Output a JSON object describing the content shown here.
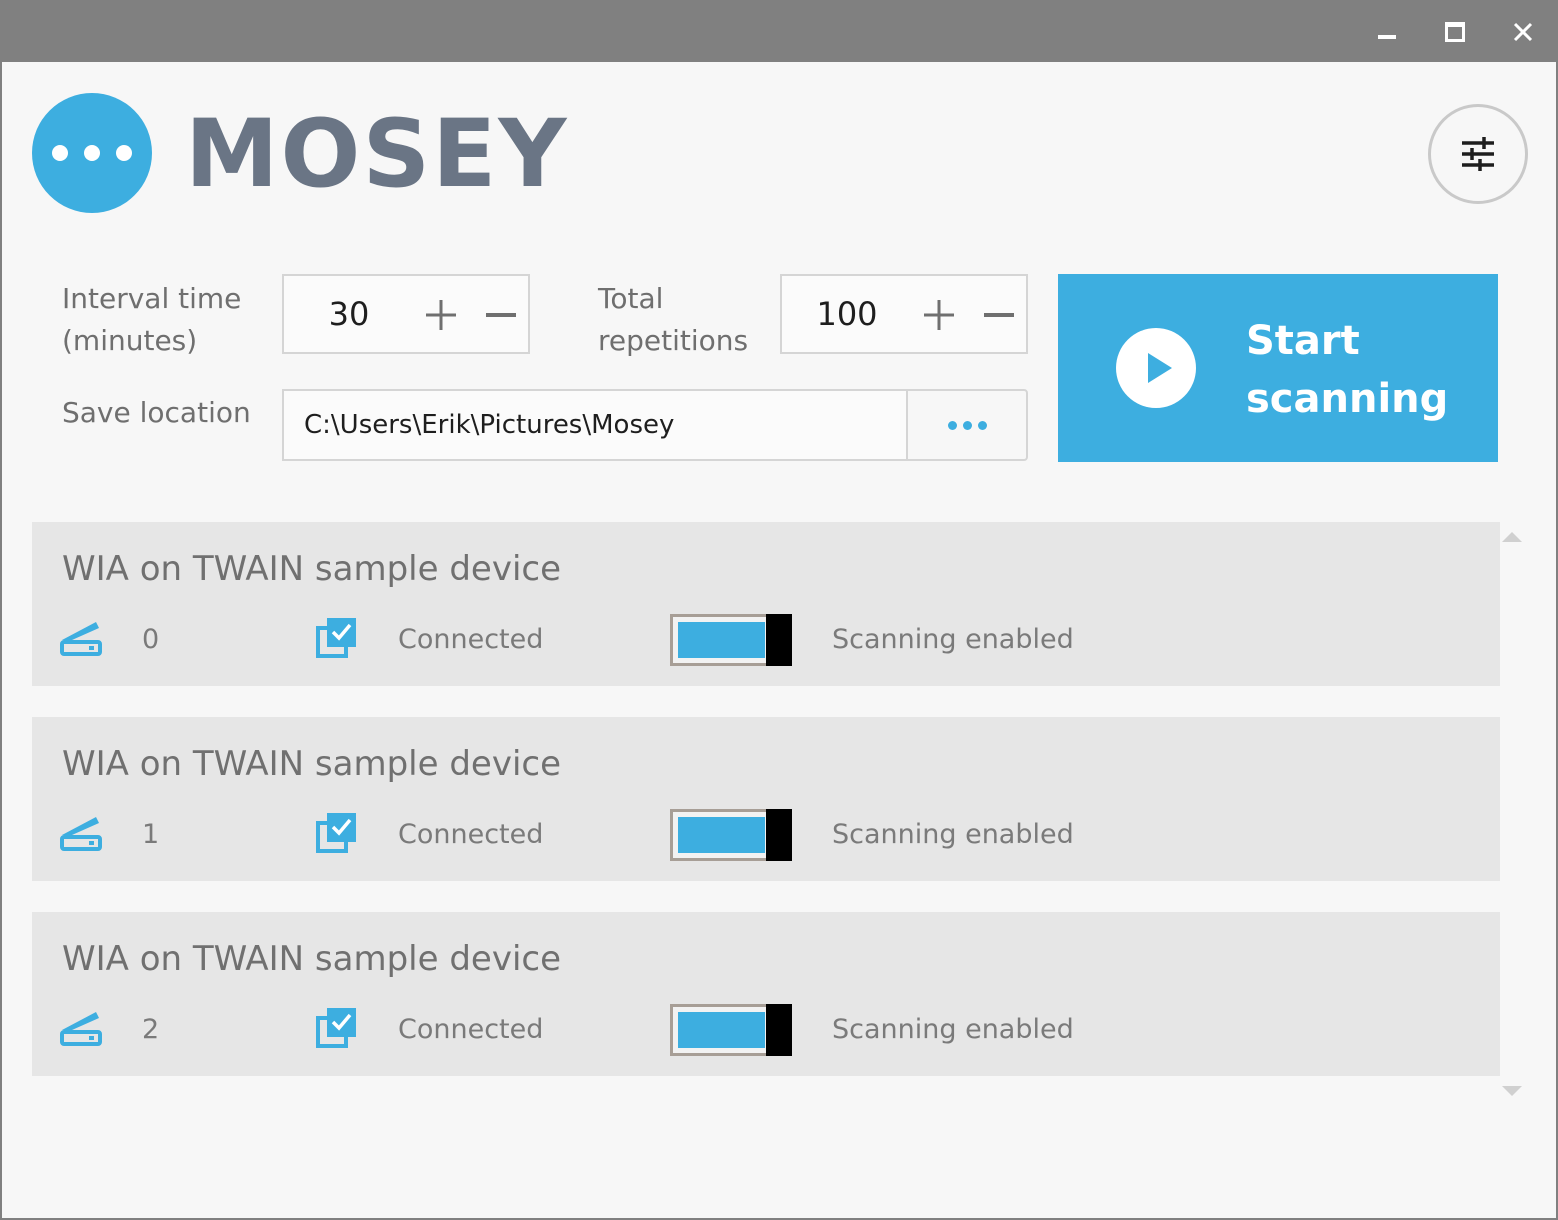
{
  "window": {
    "controls": [
      "minimize-icon",
      "maximize-icon",
      "close-icon"
    ]
  },
  "header": {
    "app_name": "MOSEY",
    "logo_icon": "ellipsis-circle-icon",
    "settings_icon": "sliders-icon"
  },
  "form": {
    "interval_label": "Interval time (minutes)",
    "interval_value": "30",
    "repetitions_label": "Total repetitions",
    "repetitions_value": "100",
    "save_location_label": "Save location",
    "save_location_value": "C:\\Users\\Erik\\Pictures\\Mosey",
    "browse_icon": "ellipsis-icon",
    "plus_icon": "plus-icon",
    "minus_icon": "minus-icon"
  },
  "start_button": {
    "label": "Start scanning",
    "icon": "play-icon"
  },
  "devices": [
    {
      "name": "WIA on TWAIN sample device",
      "index": "0",
      "status": "Connected",
      "scanning": "Scanning enabled",
      "enabled": true
    },
    {
      "name": "WIA on TWAIN sample device",
      "index": "1",
      "status": "Connected",
      "scanning": "Scanning enabled",
      "enabled": true
    },
    {
      "name": "WIA on TWAIN sample device",
      "index": "2",
      "status": "Connected",
      "scanning": "Scanning enabled",
      "enabled": true
    }
  ],
  "colors": {
    "accent": "#3daee0",
    "title_text": "#6a7585",
    "titlebar": "#808080",
    "background": "#f7f7f7",
    "card": "#e6e6e6"
  }
}
